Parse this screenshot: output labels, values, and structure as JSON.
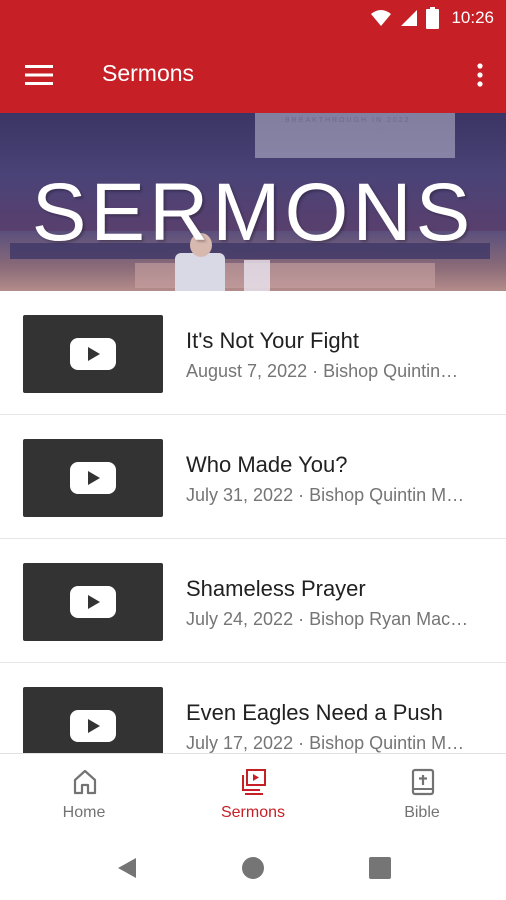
{
  "status_bar": {
    "time": "10:26"
  },
  "app_bar": {
    "title": "Sermons",
    "menu_icon": "hamburger-menu-icon",
    "more_icon": "more-vert-icon"
  },
  "hero": {
    "title": "SERMONS",
    "screen_text": "BREAKTHROUGH IN 2022"
  },
  "sermons": [
    {
      "title": "It's Not Your Fight",
      "meta": "August 7, 2022 · Bishop Quintin…"
    },
    {
      "title": "Who Made You?",
      "meta": "July 31, 2022 · Bishop Quintin M…"
    },
    {
      "title": "Shameless Prayer",
      "meta": "July 24, 2022 · Bishop Ryan Mac…"
    },
    {
      "title": "Even Eagles Need a Push",
      "meta": "July 17, 2022 · Bishop Quintin M…"
    }
  ],
  "bottom_nav": {
    "items": [
      {
        "label": "Home",
        "icon": "home-icon",
        "active": false
      },
      {
        "label": "Sermons",
        "icon": "video-library-icon",
        "active": true
      },
      {
        "label": "Bible",
        "icon": "bible-icon",
        "active": false
      }
    ]
  },
  "colors": {
    "brand": "#c62026",
    "thumbnail_bg": "#333333",
    "text_primary": "#212121",
    "text_secondary": "#757575",
    "nav_inactive": "#737373"
  }
}
